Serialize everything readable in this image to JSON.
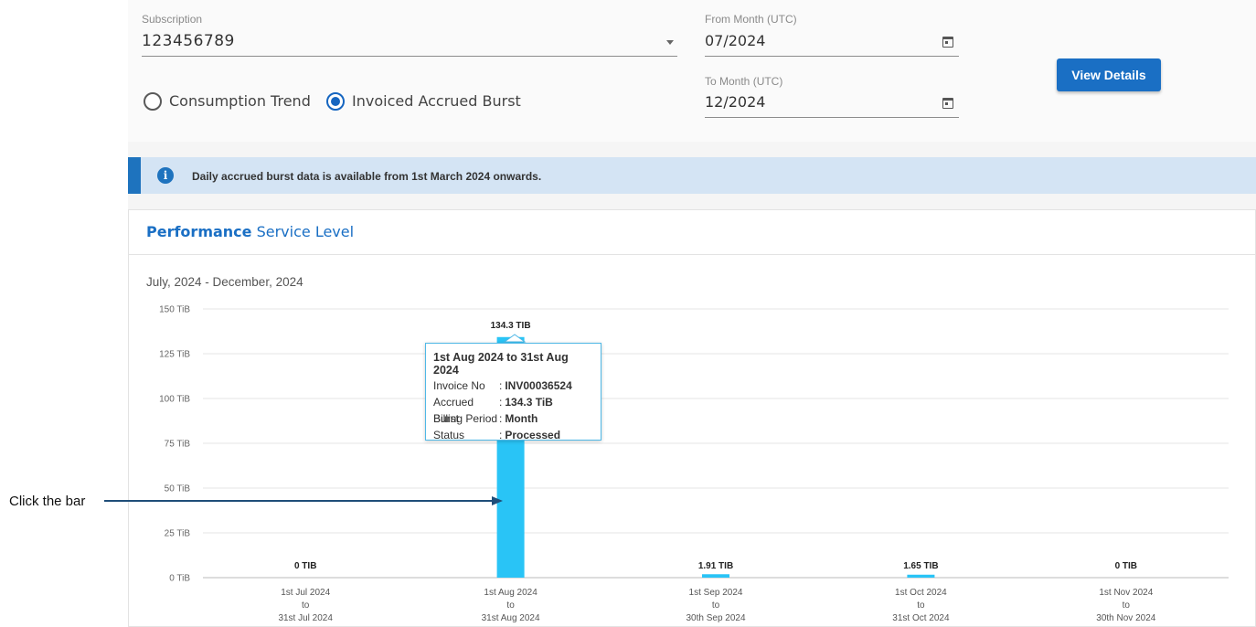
{
  "filters": {
    "subscription_label": "Subscription",
    "subscription_value": "123456789",
    "from_label": "From Month (UTC)",
    "from_value": "07/2024",
    "to_label": "To Month (UTC)",
    "to_value": "12/2024",
    "view_button": "View Details"
  },
  "radios": {
    "option1": "Consumption Trend",
    "option2": "Invoiced Accrued Burst",
    "selected": "Invoiced Accrued Burst"
  },
  "info": {
    "icon": "i",
    "text": "Daily accrued burst data is available from 1st March 2024 onwards."
  },
  "card": {
    "title_bold": "Performance",
    "title_rest": " Service Level",
    "period": "July, 2024 - December, 2024"
  },
  "tooltip": {
    "title": "1st Aug 2024 to 31st Aug 2024",
    "rows": [
      {
        "key": "Invoice No",
        "value": "INV00036524"
      },
      {
        "key": "Accrued Burst",
        "value": "134.3 TiB"
      },
      {
        "key": "Billing Period",
        "value": "Month"
      },
      {
        "key": "Status",
        "value": "Processed"
      }
    ]
  },
  "annotation": {
    "text": "Click the bar"
  },
  "colors": {
    "bar": "#29c4f6",
    "accent": "#1a6fc4"
  },
  "chart_data": {
    "type": "bar",
    "ylim": [
      0,
      150
    ],
    "yticks": [
      0,
      25,
      50,
      75,
      100,
      125,
      150
    ],
    "yunit": "TiB",
    "grid": true,
    "categories": [
      [
        "1st Jul 2024",
        "to",
        "31st Jul 2024"
      ],
      [
        "1st Aug 2024",
        "to",
        "31st Aug 2024"
      ],
      [
        "1st Sep 2024",
        "to",
        "30th Sep 2024"
      ],
      [
        "1st Oct 2024",
        "to",
        "31st Oct 2024"
      ],
      [
        "1st Nov 2024",
        "to",
        "30th Nov 2024"
      ]
    ],
    "values": [
      0,
      134.3,
      1.91,
      1.65,
      0
    ],
    "data_labels": [
      "0 TIB",
      "134.3 TIB",
      "1.91 TIB",
      "1.65 TIB",
      "0 TIB"
    ]
  }
}
